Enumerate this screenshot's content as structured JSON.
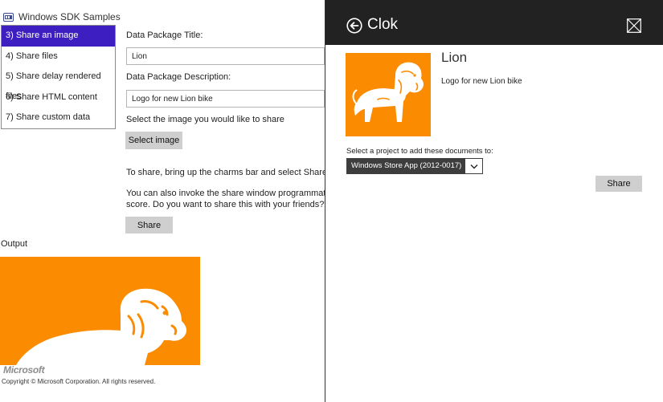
{
  "app": {
    "title": "Windows SDK Samples"
  },
  "scenarios": [
    "3) Share an image",
    "4) Share files",
    "5) Share delay rendered files",
    "6) Share HTML content",
    "7) Share custom data"
  ],
  "selected_scenario_index": 0,
  "form": {
    "title_label": "Data Package Title:",
    "title_value": "Lion",
    "description_label": "Data Package Description:",
    "description_value": "Logo for new Lion bike",
    "image_prompt": "Select the image you would like to share",
    "select_image_button": "Select image",
    "charms_instruction": "To share, bring up the charms bar and select Share (or pre",
    "programmatic_line1": "You can also invoke the share window programmatically a",
    "programmatic_line2": "score. Do you want to share this with your friends?\")",
    "share_button": "Share"
  },
  "output": {
    "label": "Output"
  },
  "footer": {
    "microsoft_logo": "Microsoft",
    "copyright": "Copyright © Microsoft Corporation. All rights reserved."
  },
  "share_pane": {
    "app_name": "Clok",
    "item_title": "Lion",
    "item_description": "Logo for new Lion bike",
    "project_label": "Select a project to add these documents to:",
    "project_selected": "Windows Store App (2012-0017)",
    "share_button": "Share"
  },
  "colors": {
    "accent_purple": "#3d1fc1",
    "lion_orange": "#fb8b00",
    "share_header": "#222222",
    "button_gray": "#cfcfcf"
  },
  "icons": {
    "app_logo": "windows-sdk-logo-icon",
    "back": "back-arrow-circle-icon",
    "close": "close-box-icon",
    "dropdown": "chevron-down-icon",
    "lion": "lion-logo-icon"
  }
}
